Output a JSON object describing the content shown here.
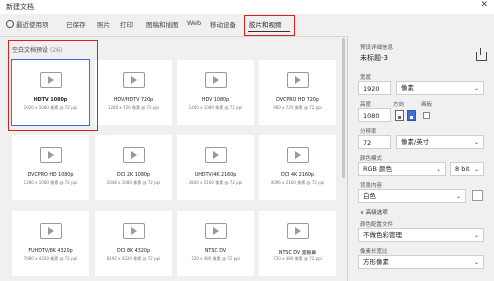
{
  "window": {
    "title": "新建文档",
    "close_glyph": "✕"
  },
  "tabs": [
    {
      "label": "最近使用项",
      "has_icon": true
    },
    {
      "label": "已保存"
    },
    {
      "label": "照片"
    },
    {
      "label": "打印"
    },
    {
      "label": "图稿和插图"
    },
    {
      "label": "Web"
    },
    {
      "label": "移动设备"
    },
    {
      "label": "胶片和视频",
      "active": true
    }
  ],
  "section": {
    "label": "空白文档预设",
    "count": "(26)"
  },
  "presets": [
    {
      "name": "HDTV 1080p",
      "sub": "1920 x 1080 像素 @ 72 ppi",
      "selected": true
    },
    {
      "name": "HDV/HDTV 720p",
      "sub": "1280 x 720 像素 @ 72 ppi"
    },
    {
      "name": "HDV 1080p",
      "sub": "1440 x 1080 像素 @ 72 ppi"
    },
    {
      "name": "DVCPRO HD 720p",
      "sub": "960 x 720 像素 @ 72 ppi"
    },
    {
      "name": "DVCPRO HD 1080p",
      "sub": "1280 x 1080 像素 @ 72 ppi"
    },
    {
      "name": "DCI 2K 1080p",
      "sub": "2048 x 1080 像素 @ 72 ppi"
    },
    {
      "name": "UHDTV/4K 2160p",
      "sub": "3840 x 2160 像素 @ 72 ppi"
    },
    {
      "name": "DCI 4K 2160p",
      "sub": "4096 x 2160 像素 @ 72 ppi"
    },
    {
      "name": "FUHDTV/8K 4320p",
      "sub": "7680 x 4320 像素 @ 72 ppi"
    },
    {
      "name": "DCI 8K 4320p",
      "sub": "8192 x 4320 像素 @ 72 ppi"
    },
    {
      "name": "NTSC DV",
      "sub": "720 x 480 像素 @ 72 ppi"
    },
    {
      "name": "NTSC DV 宽银幕",
      "sub": "720 x 480 像素 @ 72 ppi"
    }
  ],
  "details": {
    "header": "预设详细信息",
    "doc_name": "未标题-3",
    "save_icon": "save-preset-icon",
    "width_label": "宽度",
    "width_value": "1920",
    "width_unit": "像素",
    "height_label": "高度",
    "height_value": "1080",
    "orientation_label": "方向",
    "artboard_label": "画板",
    "resolution_label": "分辨率",
    "resolution_value": "72",
    "resolution_unit": "像素/英寸",
    "color_mode_label": "颜色模式",
    "color_mode_value": "RGB 颜色",
    "bit_depth_value": "8 bit",
    "background_label": "背景内容",
    "background_value": "白色",
    "advanced_label": "∨ 高级选项",
    "color_profile_label": "颜色配置文件",
    "color_profile_value": "不做色彩管理",
    "pixel_aspect_label": "像素长宽比",
    "pixel_aspect_value": "方形像素"
  }
}
